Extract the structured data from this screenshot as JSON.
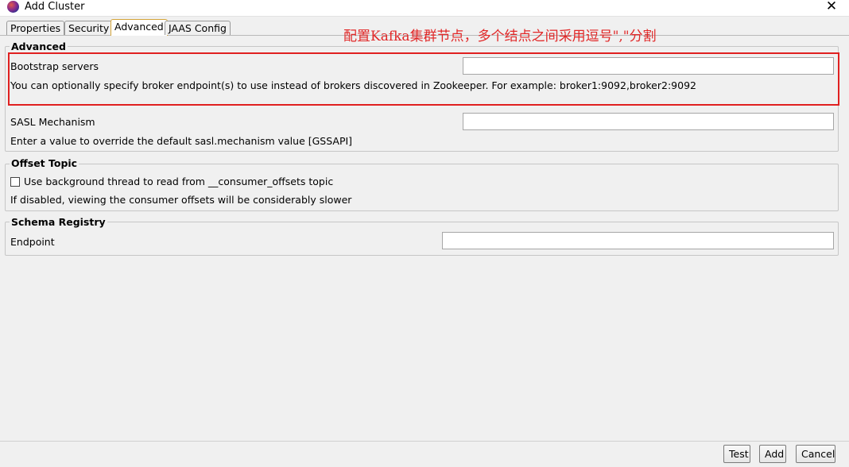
{
  "window": {
    "title": "Add Cluster",
    "close_glyph": "✕",
    "icon": "app-logo-icon"
  },
  "tabs": [
    {
      "label": "Properties"
    },
    {
      "label": "Security"
    },
    {
      "label": "Advanced",
      "selected": true
    },
    {
      "label": "JAAS Config"
    }
  ],
  "annotation": "配置Kafka集群节点，多个结点之间采用逗号\",\"分割",
  "advanced": {
    "legend": "Advanced",
    "bootstrap_label": "Bootstrap servers",
    "bootstrap_value": "",
    "bootstrap_help": "You can optionally specify broker endpoint(s) to use instead of brokers discovered in Zookeeper. For example: broker1:9092,broker2:9092",
    "sasl_label": "SASL Mechanism",
    "sasl_value": "",
    "sasl_help": "Enter a value to override the default sasl.mechanism value [GSSAPI]"
  },
  "offset_topic": {
    "legend": "Offset Topic",
    "checkbox_label": "Use background thread to read from __consumer_offsets topic",
    "checked": false,
    "help": "If disabled, viewing the consumer offsets will be considerably slower"
  },
  "schema_registry": {
    "legend": "Schema Registry",
    "endpoint_label": "Endpoint",
    "endpoint_value": ""
  },
  "buttons": {
    "test": "Test",
    "add": "Add",
    "cancel": "Cancel"
  },
  "colors": {
    "annotation": "#e12828",
    "highlight_box": "#e02020",
    "active_tab_border": "#d5a53a"
  }
}
